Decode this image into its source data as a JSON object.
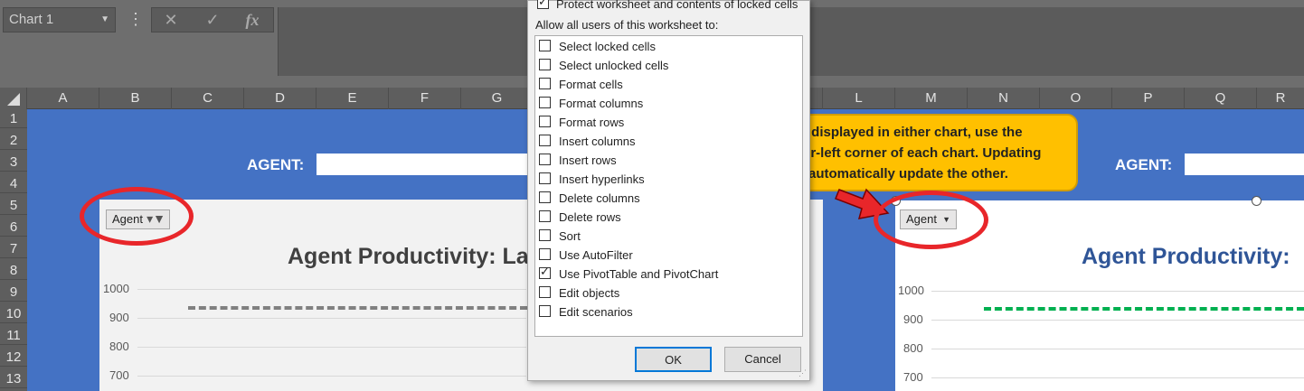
{
  "formula_bar": {
    "name_box": "Chart 1",
    "menu_dots": "⋮",
    "cancel_glyph": "✕",
    "enter_glyph": "✓",
    "fx_glyph": "fx"
  },
  "columns": [
    "A",
    "B",
    "C",
    "D",
    "E",
    "F",
    "G",
    "",
    "",
    "",
    "",
    "L",
    "M",
    "N",
    "O",
    "P",
    "Q",
    "R"
  ],
  "rows": [
    "1",
    "2",
    "3",
    "4",
    "5",
    "6",
    "7",
    "8",
    "9",
    "10",
    "11",
    "12",
    "13"
  ],
  "sheet": {
    "agent_label_left": "AGENT:",
    "agent_label_right": "AGENT:"
  },
  "chart_left": {
    "filter_label": "Agent",
    "title": "Agent Productivity: La",
    "y_ticks": [
      "1000",
      "900",
      "800",
      "700"
    ],
    "title_color": "#404040",
    "target_line_color": "#808080"
  },
  "chart_right": {
    "filter_label": "Agent",
    "title": "Agent Productivity:",
    "y_ticks": [
      "1000",
      "900",
      "800",
      "700"
    ],
    "title_color": "#2f5597",
    "target_line_color": "#00b050"
  },
  "callout": {
    "lines": [
      "t displayed in either chart, use the",
      "er-left corner of each chart. Updating",
      "automatically update the other."
    ]
  },
  "dialog": {
    "protect_label": "Protect worksheet and contents of locked cells",
    "allow_label": "Allow all users of this worksheet to:",
    "permissions": [
      {
        "label": "Select locked cells",
        "checked": false
      },
      {
        "label": "Select unlocked cells",
        "checked": false
      },
      {
        "label": "Format cells",
        "checked": false
      },
      {
        "label": "Format columns",
        "checked": false
      },
      {
        "label": "Format rows",
        "checked": false
      },
      {
        "label": "Insert columns",
        "checked": false
      },
      {
        "label": "Insert rows",
        "checked": false
      },
      {
        "label": "Insert hyperlinks",
        "checked": false
      },
      {
        "label": "Delete columns",
        "checked": false
      },
      {
        "label": "Delete rows",
        "checked": false
      },
      {
        "label": "Sort",
        "checked": false
      },
      {
        "label": "Use AutoFilter",
        "checked": false
      },
      {
        "label": "Use PivotTable and PivotChart",
        "checked": true
      },
      {
        "label": "Edit objects",
        "checked": false
      },
      {
        "label": "Edit scenarios",
        "checked": false
      }
    ],
    "ok_label": "OK",
    "cancel_label": "Cancel"
  },
  "colors": {
    "sheet_blue": "#4472c4",
    "callout_fill": "#ffc000",
    "highlight_red": "#e8262a"
  }
}
